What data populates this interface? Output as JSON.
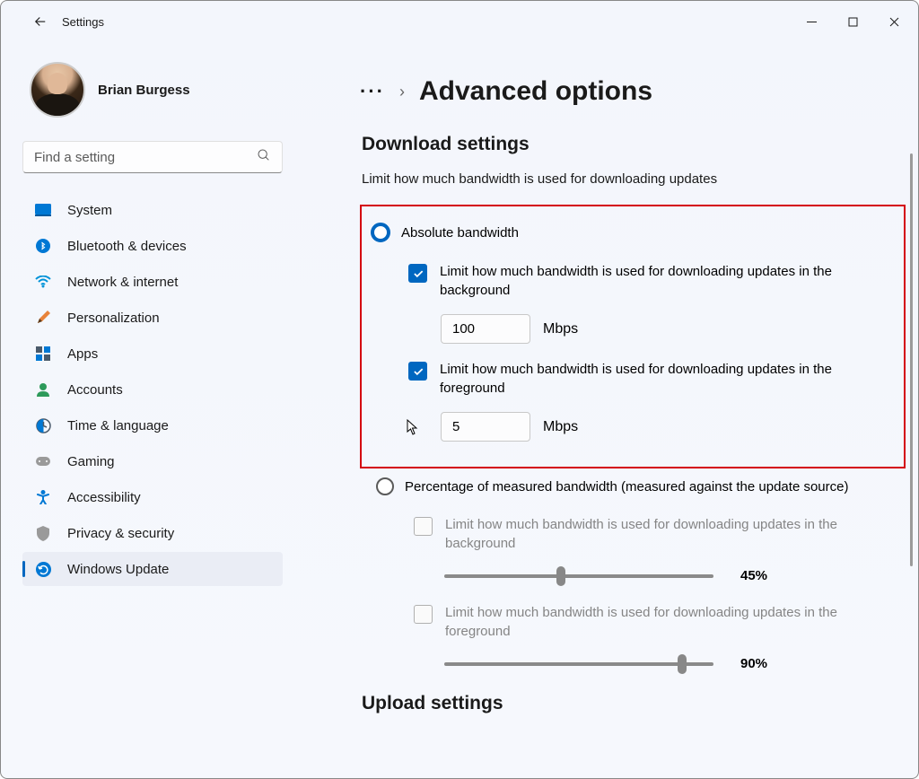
{
  "window": {
    "title": "Settings"
  },
  "profile": {
    "name": "Brian Burgess"
  },
  "search": {
    "placeholder": "Find a setting"
  },
  "nav": {
    "items": [
      {
        "label": "System"
      },
      {
        "label": "Bluetooth & devices"
      },
      {
        "label": "Network & internet"
      },
      {
        "label": "Personalization"
      },
      {
        "label": "Apps"
      },
      {
        "label": "Accounts"
      },
      {
        "label": "Time & language"
      },
      {
        "label": "Gaming"
      },
      {
        "label": "Accessibility"
      },
      {
        "label": "Privacy & security"
      },
      {
        "label": "Windows Update"
      }
    ]
  },
  "breadcrumb": {
    "title": "Advanced options"
  },
  "download": {
    "heading": "Download settings",
    "desc": "Limit how much bandwidth is used for downloading updates",
    "absolute": {
      "label": "Absolute bandwidth",
      "bg": {
        "label": "Limit how much bandwidth is used for downloading updates in the background",
        "value": "100",
        "unit": "Mbps"
      },
      "fg": {
        "label": "Limit how much bandwidth is used for downloading updates in the foreground",
        "value": "5",
        "unit": "Mbps"
      }
    },
    "percent": {
      "label": "Percentage of measured bandwidth (measured against the update source)",
      "bg": {
        "label": "Limit how much bandwidth is used for downloading updates in the background",
        "pct": "45%"
      },
      "fg": {
        "label": "Limit how much bandwidth is used for downloading updates in the foreground",
        "pct": "90%"
      }
    }
  },
  "upload": {
    "heading": "Upload settings"
  }
}
